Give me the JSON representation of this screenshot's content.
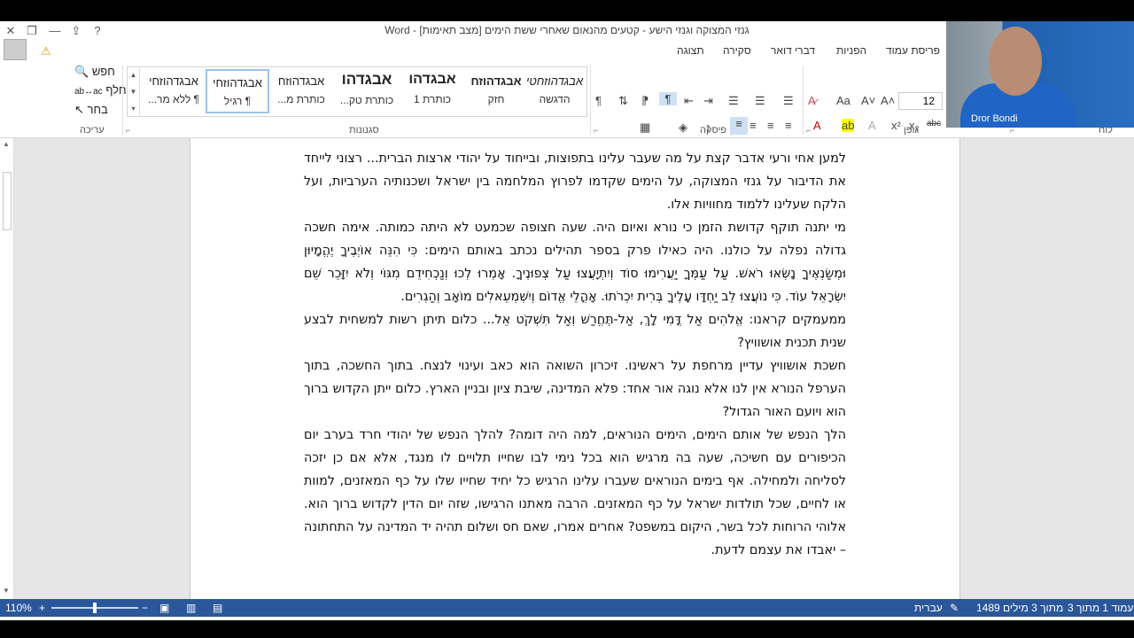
{
  "window": {
    "title": "גנזי המצוקה וגנזי הישע - קטעים מהנאום שאחרי ששת הימים [מצב תאימות] - Word",
    "controls": [
      "✕",
      "❐",
      "—",
      "⇪",
      "?"
    ]
  },
  "ribbon_tabs": [
    "פריסת עמוד",
    "הפניות",
    "דברי דואר",
    "סקירה",
    "תצוגה"
  ],
  "ribbon": {
    "groups": {
      "clipboard": "לוח",
      "font": "גופן",
      "paragraph": "פיסקה",
      "styles": "סגנונות",
      "editing": "עריכה"
    },
    "font_size": "12",
    "styles": [
      {
        "sample": "אבגדהוזחטי",
        "name": "הדגשה"
      },
      {
        "sample": "אבגדהוזח",
        "name": "חזק"
      },
      {
        "sample": "אבגדהו",
        "name": "כותרת 1"
      },
      {
        "sample": "אבגדהו",
        "name": "כותרת טק..."
      },
      {
        "sample": "אבגדהוזח",
        "name": "כותרת מ..."
      },
      {
        "sample": "אבגדהוזחי",
        "name": "¶ רגיל"
      },
      {
        "sample": "אבגדהוזחי",
        "name": "¶ ללא מר..."
      }
    ],
    "editing": {
      "find": "חפש",
      "replace": "החלף",
      "select": "בחר"
    }
  },
  "document": {
    "paragraphs": [
      "למען אחי ורעי אדבר קצת על מה שעבר עלינו בתפוצות, ובייחוד על יהודי ארצות הברית... רצוני לייחד את הדיבור על גנזי המצוקה, על הימים שקדמו לפרוץ המלחמה בין ישראל ושכנותיה הערביות, ועל הלקח שעלינו ללמוד מחוויות אלו.",
      "מי יתנה תוקף קדושת הזמן כי נורא ואיום היה. שעה חצופה שכמעט לא היתה כמותה. אימה חשכה גדולה נפלה על כולנו. היה כאילו פרק בספר תהילים נכתב באותם הימים: כִּי הִנֵּה אוֹיְבֶיךָ יֶהֱמָיוּן וּמְשַׂנְאֶיךָ נָשְׂאוּ רֹאשׁ. עַל עַמְּךָ יַעֲרִימוּ סוֹד וְיִתְיָעֲצוּ עַל צְפוּנֶיךָ. אָמְרוּ לְכוּ וְנַכְחִידֵם מִגּוֹי וְלֹא יִזָּכֵר שֵׁם יִשְׂרָאֵל עוֹד. כִּי נוֹעֲצוּ לֵב יַחְדָּו עָלֶיךָ בְּרִית יִכְרֹתוּ. אָהֳלֵי אֱדוֹם וְיִשְׁמְעֵאלִים מוֹאָב וְהַגְרִים.",
      "ממעמקים קראנו: אֱלֹהִים אַל דֳּמִי לָךְ, אַל-תֶּחֱרַשׁ וְאַל תִּשְׁקֹט אֵל... כלום תיתן רשות למשחית לבצע שנית תכנית אושוויץ?",
      "חשכת אושוויץ עדיין מרחפת על ראשינו. זיכרון השואה הוא כאב ועינוי לנצח. בתוך החשכה, בתוך הערפל הנורא אין לנו אלא נוגה אור אחד: פלא המדינה, שיבת ציון ובניין הארץ. כלום ייתן הקדוש ברוך הוא ויועם האור הגדול?",
      "הלך הנפש של אותם הימים, הימים הנוראים, למה היה דומה? להלך הנפש של יהודי חרד בערב יום הכיפורים עם חשיכה, שעה בה מרגיש הוא בכל נימי לבו שחייו תלויים לו מנגד, אלא אם כן יזכה לסליחה ולמחילה. אף בימים הנוראים שעברו עלינו הרגיש כל יחיד שחייו שלו על כף המאזנים, למוות או לחיים, שכל תולדות ישראל על כף המאזנים. הרבה מאתנו הרגישו, שזה יום הדין לקדוש ברוך הוא. אלוהי הרוחות לכל בשר, היקום במשפט? אחרים אמרו, שאם חס ושלום תהיה יד המדינה על התחתונה – יאבדו את עצמם לדעת."
    ]
  },
  "statusbar": {
    "page": "עמוד 1 מתוך 3",
    "words": "1489 מתוך 3 מילים",
    "language": "עברית",
    "zoom": "110%",
    "zoom_fraction": 0.5
  },
  "webcam": {
    "name": "Dror Bondi"
  }
}
